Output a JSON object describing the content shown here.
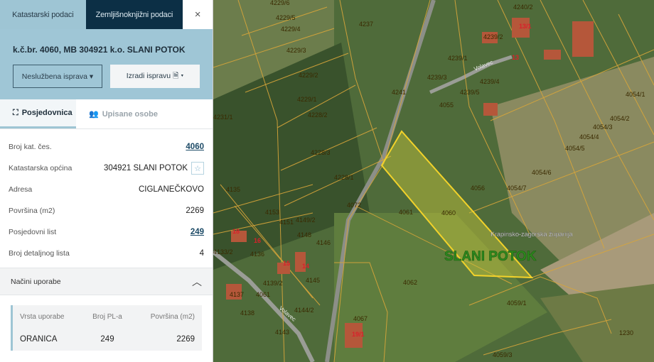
{
  "tabs": {
    "cadastral": "Katastarski podaci",
    "land_registry": "Zemljišnoknjižni podaci",
    "close": "×"
  },
  "header": {
    "title": "k.č.br. 4060, MB 304921 k.o. SLANI POTOK",
    "btn_unofficial": "Neslužbena isprava ▾",
    "btn_create": "Izradi ispravu 🗎 ▾"
  },
  "subtabs": {
    "posjedovnica": "Posjedovnica",
    "upisane": "Upisane osobe"
  },
  "details": [
    {
      "label": "Broj kat. čes.",
      "value": "4060"
    },
    {
      "label": "Katastarska općina",
      "value": "304921 SLANI POTOK"
    },
    {
      "label": "Adresa",
      "value": "CIGLANEČKOVO"
    },
    {
      "label": "Površina (m2)",
      "value": "2269"
    },
    {
      "label": "Posjedovni list",
      "value": "249"
    },
    {
      "label": "Broj detaljnog lista",
      "value": "4"
    }
  ],
  "usage": {
    "title": "Načini uporabe",
    "headers": [
      "Vrsta uporabe",
      "Broj PL-a",
      "Površina (m2)"
    ],
    "rows": [
      [
        "ORANICA",
        "249",
        "2269"
      ]
    ]
  },
  "map": {
    "parcels": [
      "4229/6",
      "4229/5",
      "4229/4",
      "4237",
      "4229/3",
      "4229/2",
      "4229/1",
      "4231/1",
      "4228/2",
      "4228/3",
      "4228/1",
      "4241",
      "4239/1",
      "4239/3",
      "4239/4",
      "4239/5",
      "4239/2",
      "4055",
      "4240/2",
      "4054/1",
      "4054/2",
      "4054/3",
      "4054/4",
      "4054/5",
      "4054/6",
      "4054/7",
      "4056",
      "4060",
      "4061",
      "4062",
      "4072",
      "4135",
      "4153",
      "4151",
      "4149/2",
      "4148",
      "4146",
      "4136",
      "4133/2",
      "4139/2",
      "4145",
      "4137",
      "4061",
      "4138",
      "4144/2",
      "4143",
      "4067",
      "4059/1",
      "4059/3",
      "1230"
    ],
    "houses": [
      "13/1",
      "13",
      "18",
      "16",
      "15",
      "14",
      "19/1"
    ],
    "street": "Volavec",
    "county": "Krapinsko-zagorska županija",
    "municipality": "SLANI POTOK"
  }
}
